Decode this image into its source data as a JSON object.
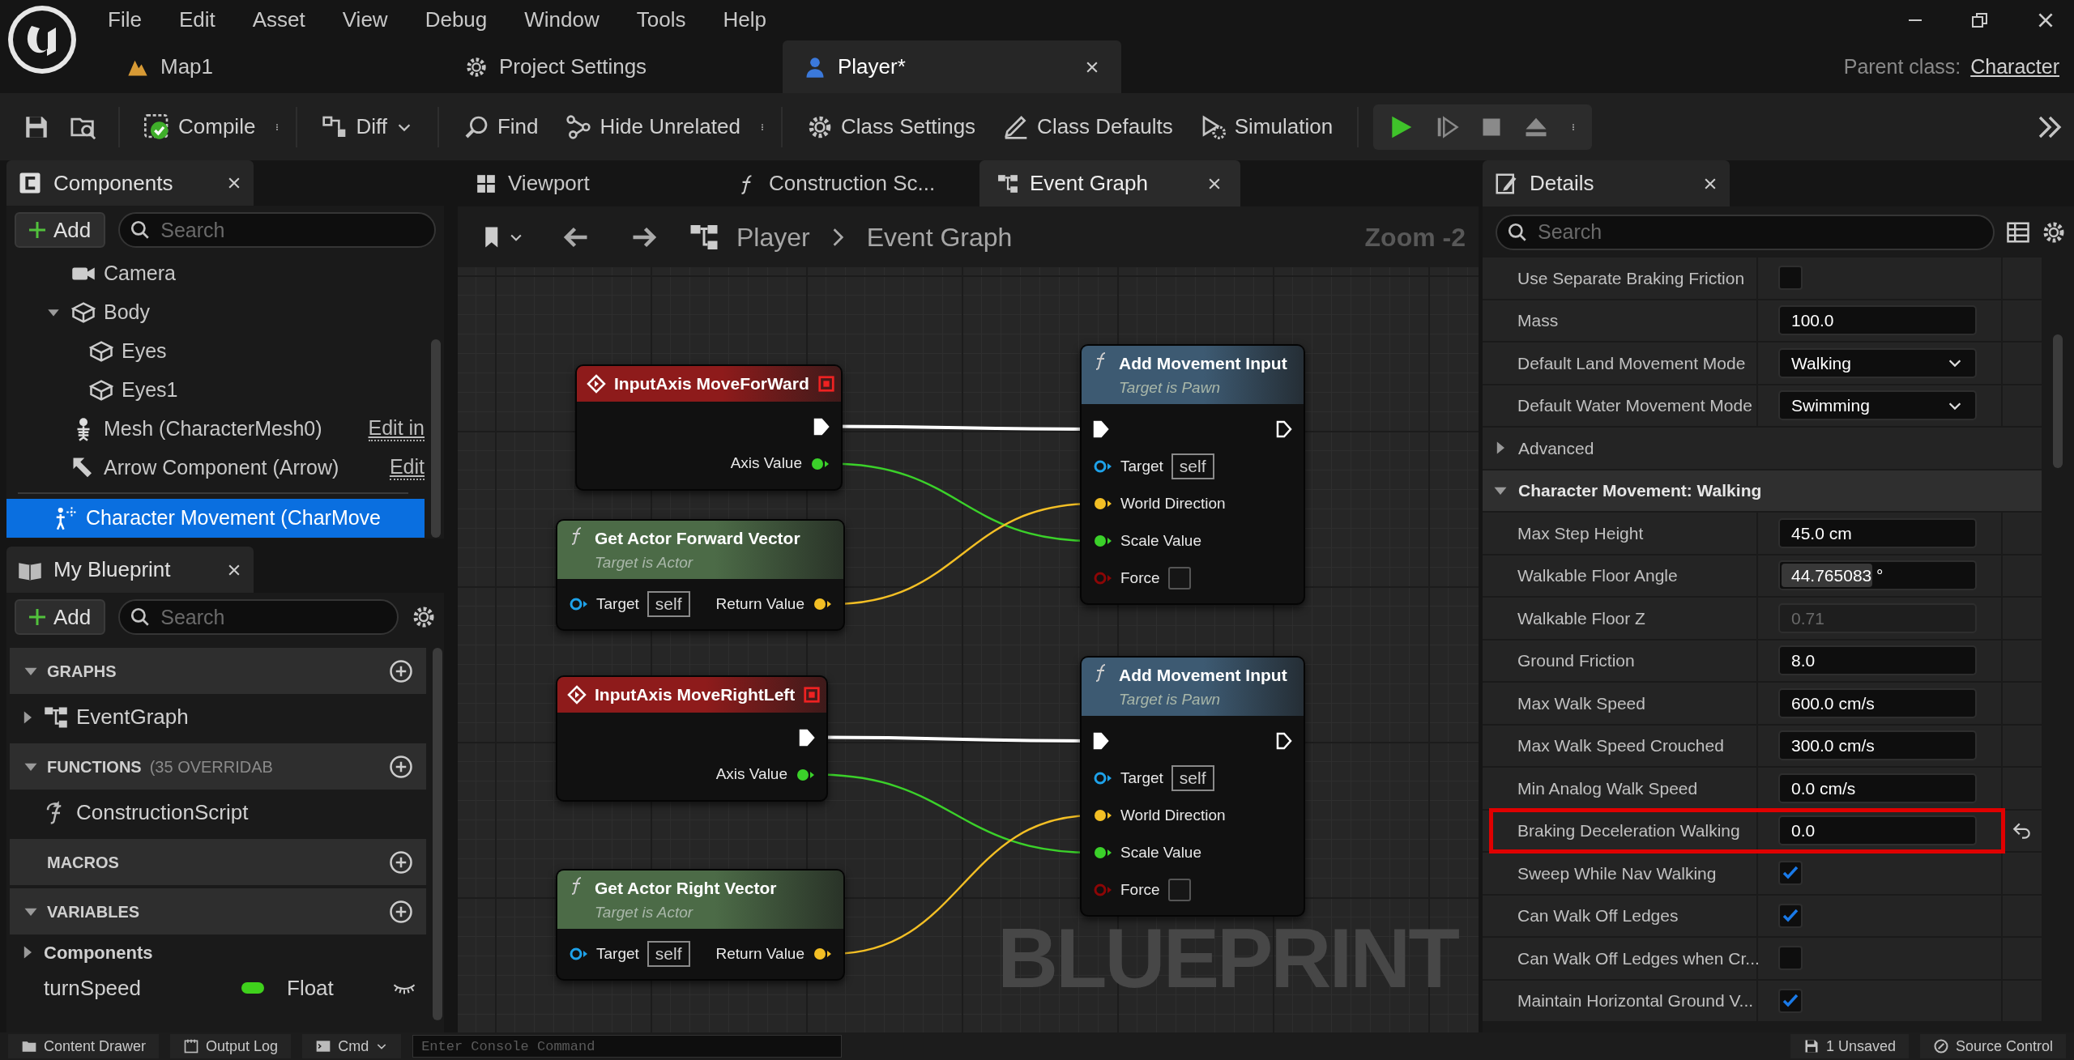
{
  "menu": [
    "File",
    "Edit",
    "Asset",
    "View",
    "Debug",
    "Window",
    "Tools",
    "Help"
  ],
  "document_tabs": [
    {
      "label": "Map1",
      "selected": false
    },
    {
      "label": "Project Settings",
      "selected": false
    },
    {
      "label": "Player*",
      "selected": true
    }
  ],
  "parent_class": {
    "label": "Parent class:",
    "value": "Character"
  },
  "toolbar": [
    {
      "label": "Compile"
    },
    {
      "label": "Diff"
    },
    {
      "label": "Find"
    },
    {
      "label": "Hide Unrelated"
    },
    {
      "label": "Class Settings"
    },
    {
      "label": "Class Defaults"
    },
    {
      "label": "Simulation"
    }
  ],
  "components": {
    "title": "Components",
    "add": "Add",
    "search_placeholder": "Search",
    "tree": [
      {
        "label": "Camera",
        "kind": "camera",
        "selected": false
      },
      {
        "label": "Body",
        "kind": "mesh",
        "selected": false,
        "expanded": true,
        "children": [
          {
            "label": "Eyes",
            "kind": "mesh",
            "selected": false
          },
          {
            "label": "Eyes1",
            "kind": "mesh",
            "selected": false
          }
        ]
      },
      {
        "label": "Mesh (CharacterMesh0)",
        "kind": "skeleton",
        "selected": false,
        "link": "Edit in"
      },
      {
        "label": "Arrow Component (Arrow)",
        "kind": "arrow",
        "selected": false,
        "link": "Edit"
      }
    ],
    "root_items": [
      {
        "label": "Character Movement (CharMove",
        "kind": "movement",
        "selected": true
      }
    ]
  },
  "my_blueprint": {
    "title": "My Blueprint",
    "add": "Add",
    "search_placeholder": "Search",
    "sections": [
      {
        "title": "GRAPHS",
        "expanded": true,
        "items": [
          {
            "kind": "graph",
            "label": "EventGraph",
            "expanded": false
          }
        ]
      },
      {
        "title": "FUNCTIONS",
        "note": "(35 OVERRIDAB",
        "expanded": true,
        "items": [
          {
            "kind": "function",
            "label": "ConstructionScript"
          }
        ]
      },
      {
        "title": "MACROS"
      },
      {
        "title": "VARIABLES",
        "expanded": true,
        "items": [
          {
            "kind": "category",
            "label": "Components",
            "expanded": false
          },
          {
            "kind": "variable",
            "label": "turnSpeed",
            "type": "Float",
            "color": "#3fd11c"
          }
        ]
      }
    ]
  },
  "editor_tabs": [
    {
      "label": "Viewport",
      "selected": false
    },
    {
      "label": "Construction Sc...",
      "selected": false
    },
    {
      "label": "Event Graph",
      "selected": true
    }
  ],
  "breadcrumb": [
    "Player",
    "Event Graph"
  ],
  "zoom_label": "Zoom -2",
  "graph": {
    "graph_label": "BLUEPRINT",
    "nodes": [
      {
        "kind": "event",
        "title": "InputAxis MoveForWard",
        "color": "#8e1b1b",
        "rows": [
          {
            "out": {
              "kind": "exec",
              "connected": true
            }
          },
          {
            "out": {
              "kind": "float",
              "label": "Axis Value",
              "connected": true
            }
          }
        ]
      },
      {
        "kind": "function",
        "title": "Get Actor Forward Vector",
        "subtitle": "Target is Actor",
        "color": "#4c6b47",
        "rows": [
          {
            "in": {
              "kind": "object",
              "label": "Target",
              "default": "self",
              "connected": false
            },
            "out": {
              "kind": "vector",
              "label": "Return Value",
              "connected": true
            }
          }
        ]
      },
      {
        "kind": "event",
        "title": "InputAxis MoveRightLeft",
        "color": "#8e1b1b",
        "rows": [
          {
            "out": {
              "kind": "exec",
              "connected": true
            }
          },
          {
            "out": {
              "kind": "float",
              "label": "Axis Value",
              "connected": true
            }
          }
        ]
      },
      {
        "kind": "function",
        "title": "Get Actor Right Vector",
        "subtitle": "Target is Actor",
        "color": "#4c6b47",
        "rows": [
          {
            "in": {
              "kind": "object",
              "label": "Target",
              "default": "self",
              "connected": false
            },
            "out": {
              "kind": "vector",
              "label": "Return Value",
              "connected": true
            }
          }
        ]
      },
      {
        "kind": "function",
        "title": "Add Movement Input",
        "subtitle": "Target is Pawn",
        "color": "#3d5a72",
        "rows": [
          {
            "in": {
              "kind": "exec",
              "connected": true
            },
            "out": {
              "kind": "exec",
              "connected": false
            }
          },
          {
            "in": {
              "kind": "object",
              "label": "Target",
              "default": "self",
              "connected": false
            }
          },
          {
            "in": {
              "kind": "vector",
              "label": "World Direction",
              "connected": true
            }
          },
          {
            "in": {
              "kind": "float",
              "label": "Scale Value",
              "connected": true
            }
          },
          {
            "in": {
              "kind": "bool",
              "label": "Force",
              "checked": false,
              "connected": false
            }
          }
        ]
      },
      {
        "kind": "function",
        "title": "Add Movement Input",
        "subtitle": "Target is Pawn",
        "color": "#3d5a72",
        "rows": [
          {
            "in": {
              "kind": "exec",
              "connected": true
            },
            "out": {
              "kind": "exec",
              "connected": false
            }
          },
          {
            "in": {
              "kind": "object",
              "label": "Target",
              "default": "self",
              "connected": false
            }
          },
          {
            "in": {
              "kind": "vector",
              "label": "World Direction",
              "connected": true
            }
          },
          {
            "in": {
              "kind": "float",
              "label": "Scale Value",
              "connected": true
            }
          },
          {
            "in": {
              "kind": "bool",
              "label": "Force",
              "checked": false,
              "connected": false
            }
          }
        ]
      }
    ]
  },
  "details": {
    "title": "Details",
    "search_placeholder": "Search",
    "rows": [
      {
        "kind": "checkbox",
        "label": "Use Separate Braking Friction",
        "checked": false,
        "highlighted": false,
        "modified": false
      },
      {
        "kind": "number",
        "label": "Mass",
        "value": "100.0",
        "disabled": false,
        "highlighted": false,
        "modified": false
      },
      {
        "kind": "dropdown",
        "label": "Default Land Movement Mode",
        "value": "Walking",
        "highlighted": false,
        "modified": false
      },
      {
        "kind": "dropdown",
        "label": "Default Water Movement Mode",
        "value": "Swimming",
        "highlighted": false,
        "modified": false
      },
      {
        "kind": "group",
        "label": "Advanced",
        "expanded": false
      },
      {
        "kind": "section",
        "label": "Character Movement: Walking",
        "expanded": true
      },
      {
        "kind": "number",
        "label": "Max Step Height",
        "value": "45.0 cm",
        "disabled": false,
        "highlighted": false,
        "modified": false
      },
      {
        "kind": "slider",
        "label": "Walkable Floor Angle",
        "value": "44.765083 °",
        "level": 0.48,
        "highlighted": false,
        "modified": false
      },
      {
        "kind": "number",
        "label": "Walkable Floor Z",
        "value": "0.71",
        "disabled": true,
        "highlighted": false,
        "modified": false
      },
      {
        "kind": "number",
        "label": "Ground Friction",
        "value": "8.0",
        "disabled": false,
        "highlighted": false,
        "modified": false
      },
      {
        "kind": "number",
        "label": "Max Walk Speed",
        "value": "600.0 cm/s",
        "disabled": false,
        "highlighted": false,
        "modified": false
      },
      {
        "kind": "number",
        "label": "Max Walk Speed Crouched",
        "value": "300.0 cm/s",
        "disabled": false,
        "highlighted": false,
        "modified": false
      },
      {
        "kind": "number",
        "label": "Min Analog Walk Speed",
        "value": "0.0 cm/s",
        "disabled": false,
        "highlighted": false,
        "modified": false
      },
      {
        "kind": "number",
        "label": "Braking Deceleration Walking",
        "value": "0.0",
        "disabled": false,
        "highlighted": true,
        "modified": true
      },
      {
        "kind": "checkbox",
        "label": "Sweep While Nav Walking",
        "checked": true,
        "highlighted": false,
        "modified": false
      },
      {
        "kind": "checkbox",
        "label": "Can Walk Off Ledges",
        "checked": true,
        "highlighted": false,
        "modified": false
      },
      {
        "kind": "checkbox",
        "label": "Can Walk Off Ledges when Cr...",
        "checked": false,
        "highlighted": false,
        "modified": false
      },
      {
        "kind": "checkbox",
        "label": "Maintain Horizontal Ground V...",
        "checked": true,
        "highlighted": false,
        "modified": false
      }
    ]
  },
  "bottom_bar": {
    "content_drawer": "Content Drawer",
    "output_log": "Output Log",
    "cmd": "Cmd",
    "console_placeholder": "Enter Console Command",
    "unsaved": "1 Unsaved",
    "source_control": "Source Control"
  }
}
